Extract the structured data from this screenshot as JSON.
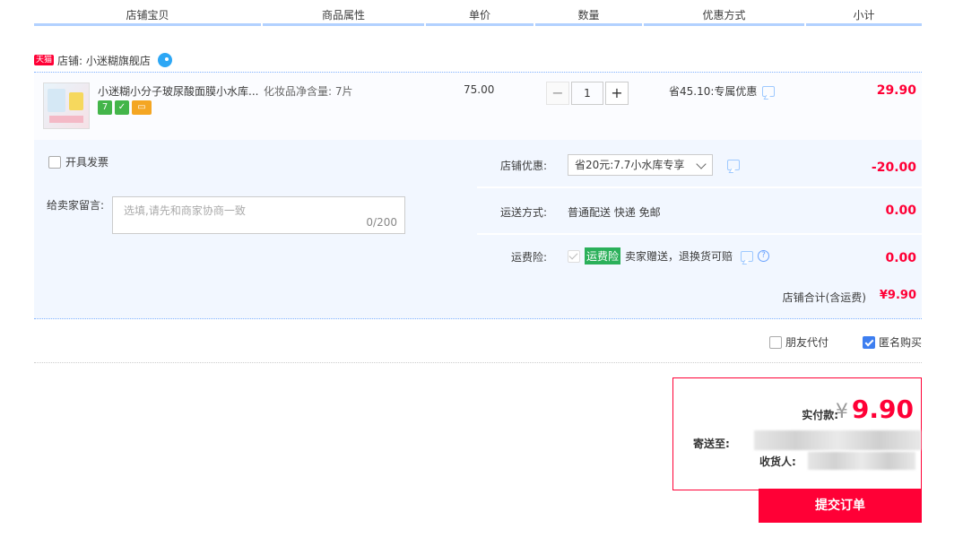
{
  "header": {
    "columns": [
      "店铺宝贝",
      "商品属性",
      "单价",
      "数量",
      "优惠方式",
      "小计"
    ]
  },
  "shop": {
    "badge": "天猫",
    "label": "店铺: 小迷糊旗舰店"
  },
  "item": {
    "title": "小迷糊小分子玻尿酸面膜小水库...",
    "attribute": "化妆品净含量: 7片",
    "unit_price": "75.00",
    "quantity": "1",
    "qty_minus": "−",
    "qty_plus": "+",
    "promotion": "省45.10:专属优惠",
    "subtotal": "29.90",
    "badges": [
      "7",
      "✓",
      "▭"
    ]
  },
  "invoice": {
    "label": "开具发票"
  },
  "message": {
    "label": "给卖家留言:",
    "placeholder": "选填,请先和商家协商一致",
    "counter": "0/200"
  },
  "shop_discount": {
    "label": "店铺优惠:",
    "selected": "省20元:7.7小水库专享",
    "value": "-20.00"
  },
  "shipping": {
    "label": "运送方式:",
    "method": "普通配送 快递 免邮",
    "value": "0.00"
  },
  "insurance": {
    "label": "运费险:",
    "tag": "运费险",
    "text": "卖家赠送，退换货可赔",
    "value": "0.00"
  },
  "shop_total": {
    "label": "店铺合计(含运费)",
    "value": "¥9.90"
  },
  "options": {
    "friend_pay": "朋友代付",
    "anonymous": "匿名购买"
  },
  "payment": {
    "actual_label": "实付款:",
    "currency": "¥",
    "amount": "9.90",
    "ship_to_label": "寄送至:",
    "receiver_label": "收货人:"
  },
  "submit": {
    "label": "提交订单"
  },
  "colors": {
    "accent": "#ff0036",
    "header_line": "#b2d1ff",
    "panel_bg": "#f2f7ff"
  }
}
